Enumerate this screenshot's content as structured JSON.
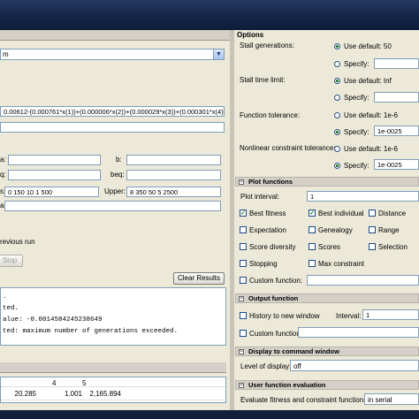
{
  "left": {
    "solver_value": "m",
    "fitness_expr": "0.00612-(0.000761*x(1))+(0.000006*x(2))+(0.000029*x(3))+(0.000301*x(4))-(0",
    "labels": {
      "a": "a:",
      "aeq": "q:",
      "lb": "s:",
      "b": "b:",
      "beq": "beq:",
      "upper": "Upper:",
      "nonlcon": "a:"
    },
    "lower_value": "0 150 10 1 500",
    "upper_value": "8 350 50 5 2500",
    "use_previous": "revious run",
    "stop_label": "Stop",
    "clear_label": "Clear Results",
    "status_lines": [
      ".",
      "ted.",
      "alue: -0.0014584245238649",
      "ted: maximum number of generations exceeded."
    ],
    "table": {
      "headers": [
        "4",
        "5"
      ],
      "row": [
        "20.285",
        "1.001",
        "2,165.894"
      ]
    }
  },
  "right": {
    "title": "Options",
    "stall_generations": {
      "label": "Stall generations:",
      "default": "Use default: 50",
      "specify": "Specify:",
      "selected": "default"
    },
    "stall_time": {
      "label": "Stall time limit:",
      "default": "Use default: Inf",
      "specify": "Specify:",
      "selected": "default"
    },
    "function_tolerance": {
      "label": "Function tolerance:",
      "default": "Use default: 1e-6",
      "specify": "Specify:",
      "value": "1e-0025",
      "selected": "specify"
    },
    "nonlinear_tolerance": {
      "label": "Nonlinear constraint tolerance:",
      "default": "Use default: 1e-6",
      "specify": "Specify:",
      "value": "1e-0025",
      "selected": "specify"
    },
    "plot_functions": {
      "header": "Plot functions",
      "interval_label": "Plot interval:",
      "interval_value": "1",
      "items": [
        {
          "label": "Best fitness",
          "checked": true
        },
        {
          "label": "Best individual",
          "checked": true
        },
        {
          "label": "Distance",
          "checked": false
        },
        {
          "label": "Expectation",
          "checked": false
        },
        {
          "label": "Genealogy",
          "checked": false
        },
        {
          "label": "Range",
          "checked": false
        },
        {
          "label": "Score diversity",
          "checked": false
        },
        {
          "label": "Scores",
          "checked": false
        },
        {
          "label": "Selection",
          "checked": false
        },
        {
          "label": "Stopping",
          "checked": false
        },
        {
          "label": "Max constraint",
          "checked": false
        }
      ],
      "custom_label": "Custom function:"
    },
    "output_function": {
      "header": "Output function",
      "history_label": "History to new window",
      "interval_label": "Interval:",
      "interval_value": "1",
      "custom_label": "Custom function:"
    },
    "display": {
      "header": "Display to command window",
      "level_label": "Level of display:",
      "level_value": "off"
    },
    "user_eval": {
      "header": "User function evaluation",
      "eval_label": "Evaluate fitness and constraint functions:",
      "eval_value": "in serial"
    }
  }
}
